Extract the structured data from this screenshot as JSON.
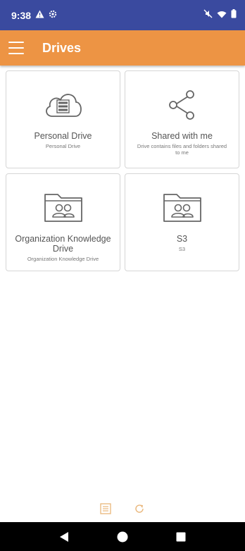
{
  "status_bar": {
    "time": "9:38",
    "icons": [
      "warning-icon",
      "settings-gear-icon",
      "mute-icon",
      "wifi-icon",
      "battery-icon"
    ]
  },
  "app_bar": {
    "title": "Drives",
    "menu_icon": "hamburger-menu-icon"
  },
  "drives": [
    {
      "title": "Personal Drive",
      "subtitle": "Personal Drive",
      "icon": "cloud-storage-icon"
    },
    {
      "title": "Shared with me",
      "subtitle": "Drive contains files and folders shared to me",
      "icon": "share-icon"
    },
    {
      "title": "Organization Knowledge Drive",
      "subtitle": "Organization Knowledge Drive",
      "icon": "shared-folder-icon"
    },
    {
      "title": "S3",
      "subtitle": "S3",
      "icon": "shared-folder-icon"
    }
  ],
  "bottom_tools": [
    "list-view-icon",
    "refresh-icon"
  ],
  "nav": [
    "back-icon",
    "home-icon",
    "recents-icon"
  ],
  "colors": {
    "status_bar": "#3a4a9f",
    "app_bar": "#ed9444",
    "accent_icon": "#e9b67a",
    "card_border": "#d6d6d6"
  }
}
